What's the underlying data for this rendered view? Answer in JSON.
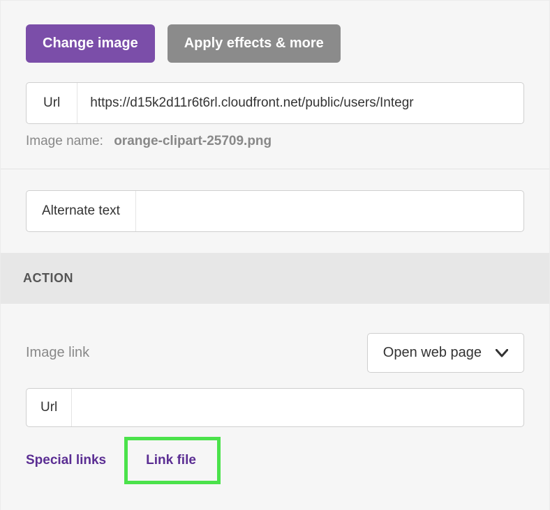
{
  "buttons": {
    "change_image": "Change image",
    "apply_effects": "Apply effects & more"
  },
  "image": {
    "url_label": "Url",
    "url_value": "https://d15k2d11r6t6rl.cloudfront.net/public/users/Integr",
    "name_label": "Image name:",
    "name_value": "orange-clipart-25709.png"
  },
  "alt": {
    "label": "Alternate text",
    "value": ""
  },
  "action": {
    "header": "ACTION",
    "image_link_label": "Image link",
    "dropdown_selected": "Open web page",
    "url_label": "Url",
    "url_value": "",
    "special_links": "Special links",
    "link_file": "Link file"
  },
  "colors": {
    "primary": "#7b4ea9",
    "secondary": "#8b8b8b",
    "highlight_box": "#4be24b",
    "link_purple": "#5b2e93"
  }
}
